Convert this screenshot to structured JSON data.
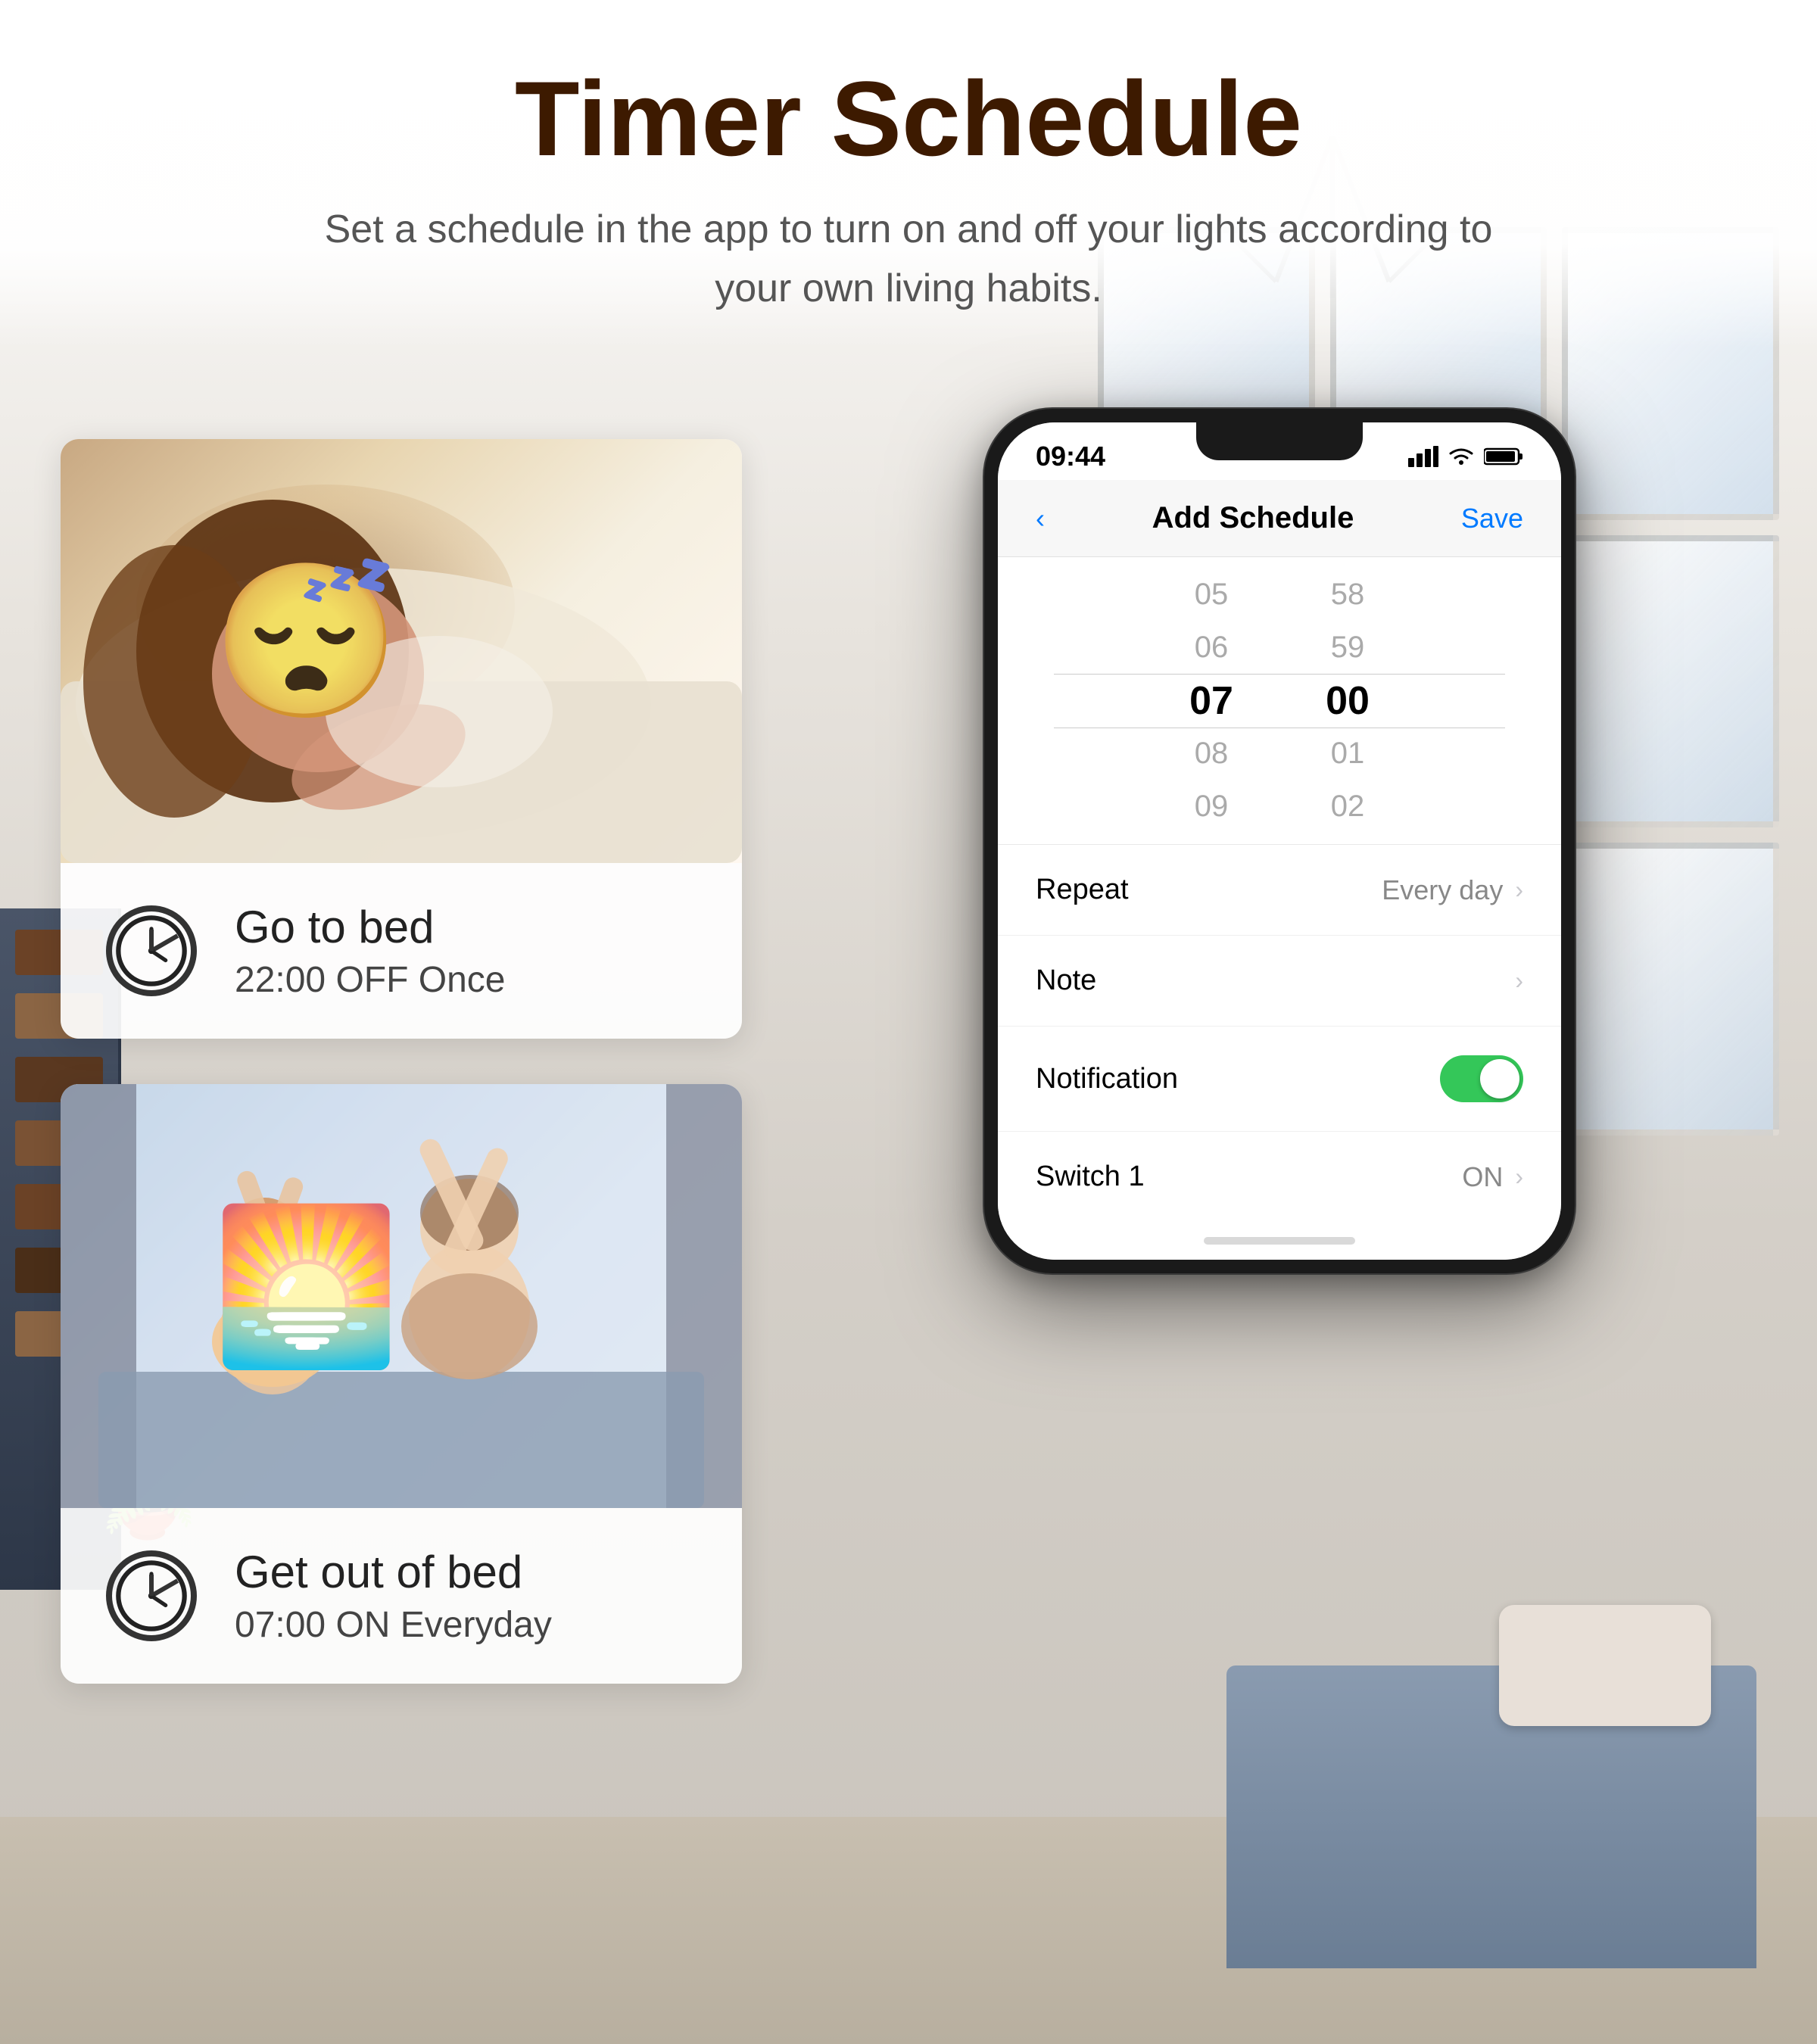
{
  "header": {
    "title": "Timer Schedule",
    "subtitle": "Set a schedule in the app to turn on and off your lights according to your own living habits."
  },
  "cards": [
    {
      "id": "go-to-bed",
      "label": "Go to bed",
      "detail": "22:00 OFF Once",
      "image_type": "sleeping"
    },
    {
      "id": "get-out-of-bed",
      "label": "Get out of bed",
      "detail": "07:00 ON Everyday",
      "image_type": "morning"
    }
  ],
  "phone": {
    "status_bar": {
      "time": "09:44",
      "signal_icon": "📶",
      "wifi_icon": "WiFi",
      "battery_icon": "🔋"
    },
    "nav": {
      "back_label": "‹",
      "title": "Add Schedule",
      "save_label": "Save"
    },
    "time_picker": {
      "hours": [
        "05",
        "06",
        "07",
        "08",
        "09"
      ],
      "minutes": [
        "58",
        "59",
        "00",
        "01",
        "02"
      ],
      "selected_hour": "07",
      "selected_minute": "00"
    },
    "settings": [
      {
        "id": "repeat",
        "label": "Repeat",
        "value": "Every day",
        "type": "nav"
      },
      {
        "id": "note",
        "label": "Note",
        "value": "",
        "type": "nav"
      },
      {
        "id": "notification",
        "label": "Notification",
        "value": "on",
        "type": "toggle"
      },
      {
        "id": "switch1",
        "label": "Switch 1",
        "value": "ON",
        "type": "nav"
      }
    ]
  }
}
